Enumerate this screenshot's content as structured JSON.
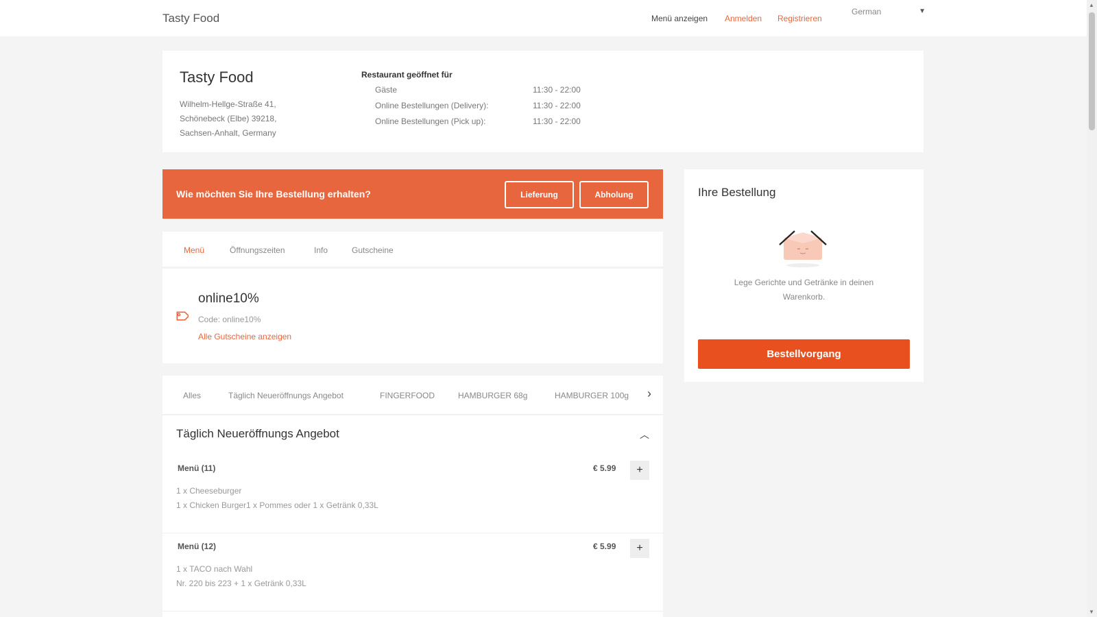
{
  "header": {
    "brand": "Tasty Food",
    "nav_menu": "Menü anzeigen",
    "nav_login": "Anmelden",
    "nav_register": "Registrieren",
    "language": "German"
  },
  "restaurant": {
    "name": "Tasty Food",
    "address_line1": "Wilhelm-Hellge-Straße 41,",
    "address_line2": "Schönebeck (Elbe) 39218,",
    "address_line3": "Sachsen-Anhalt, Germany",
    "hours_title": "Restaurant geöffnet für",
    "hours": [
      {
        "label": "Gäste",
        "time": "11:30 - 22:00"
      },
      {
        "label": "Online Bestellungen (Delivery):",
        "time": "11:30 - 22:00"
      },
      {
        "label": "Online Bestellungen (Pick up):",
        "time": "11:30 - 22:00"
      }
    ]
  },
  "order_type": {
    "question": "Wie möchten Sie Ihre Bestellung erhalten?",
    "delivery_label": "Lieferung",
    "pickup_label": "Abholung"
  },
  "tabs": [
    "Menü",
    "Öffnungszeiten",
    "Info",
    "Gutscheine"
  ],
  "coupon": {
    "name": "online10%",
    "code": "Code: online10%",
    "link": "Alle Gutscheine anzeigen"
  },
  "categories": [
    "Alles",
    "Täglich Neueröffnungs Angebot",
    "FINGERFOOD",
    "HAMBURGER 68g",
    "HAMBURGER 100g"
  ],
  "menu": {
    "section_title": "Täglich Neueröffnungs Angebot",
    "items": [
      {
        "name": "Menü (11)",
        "price": "€ 5.99",
        "desc_line1": "1 x Cheeseburger",
        "desc_line2": "1 x Chicken Burger1 x Pommes oder 1 x Getränk 0,33L"
      },
      {
        "name": "Menü (12)",
        "price": "€ 5.99",
        "desc_line1": "1 x TACO nach Wahl",
        "desc_line2": "Nr. 220 bis 223 + 1 x Getränk 0,33L"
      }
    ]
  },
  "order": {
    "title": "Ihre Bestellung",
    "empty_msg": "Lege Gerichte und Getränke in deinen Warenkorb.",
    "checkout_label": "Bestellvorgang"
  },
  "colors": {
    "accent": "#e8663d",
    "checkout": "#e8511f",
    "background": "#f4f4f4"
  }
}
